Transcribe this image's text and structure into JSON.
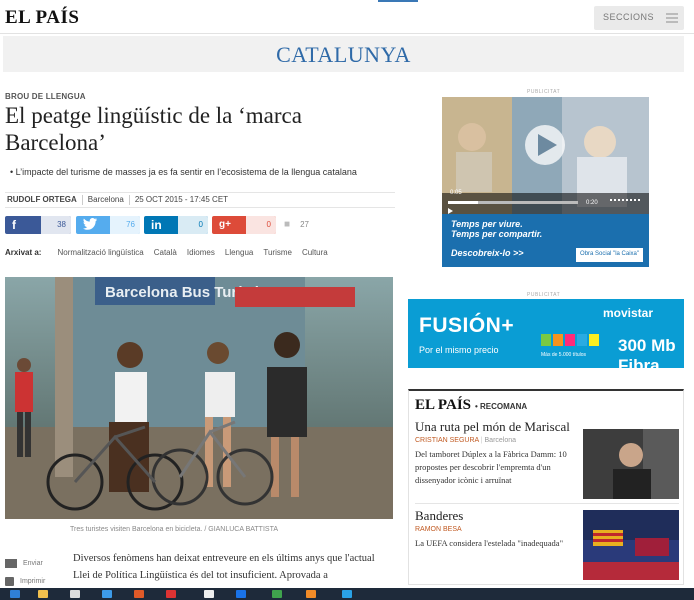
{
  "header": {
    "logo": "EL PAÍS",
    "sections_label": "SECCIONS"
  },
  "section": {
    "title": "CATALUNYA"
  },
  "article": {
    "kicker": "BROU DE LLENGUA",
    "headline": "El peatge lingüístic de la ‘marca Barcelona’",
    "subtitle": "• L’impacte del turisme de masses ja es fa sentir en l’ecosistema de la llengua catalana",
    "byline": {
      "author": "RUDOLF ORTEGA",
      "place": "Barcelona",
      "date": "25 OCT 2015 - 17:45 CET"
    },
    "share": {
      "facebook": "38",
      "twitter": "76",
      "linkedin": "0",
      "googleplus": "0",
      "comments": "27"
    },
    "archived_label": "Arxivat a:",
    "tags": [
      "Normalització lingüística",
      "Català",
      "Idiomes",
      "Llengua",
      "Turisme",
      "Cultura"
    ],
    "photo_caption": "Tres turistes visiten Barcelona en bicicleta. / GIANLUCA BATTISTA",
    "photo_sign": "Barcelona Bus Turístic",
    "tools": {
      "send": "Enviar",
      "print": "Imprimir"
    },
    "body": "Diversos fenòmens han deixat entreveure en els últims anys que l'actual Llei de Política Lingüística és del tot insuficient. Aprovada a"
  },
  "ads": {
    "label": "PUBLICITAT",
    "ad1": {
      "time_start": "0:05",
      "time_end": "0:20",
      "line1": "Temps per viure.",
      "line2": "Temps per compartir.",
      "cta": "Descobreix-lo >>",
      "brand": "Obra Social \"la Caixa\""
    },
    "ad2": {
      "title": "FUSIÓN+",
      "sub": "Por el mismo precio",
      "brand": "movistar",
      "fibra": "300 Mb Fibra",
      "titles": "Más de 5.000 títulos"
    }
  },
  "recommends": {
    "logo": "EL PAÍS",
    "label": "• RECOMANA",
    "items": [
      {
        "title": "Una ruta pel món de Mariscal",
        "author": "CRISTIAN SEGURA",
        "place": "Barcelona",
        "desc": "Del tamboret Dúplex a la Fàbrica Damm: 10 propostes per descobrir l'empremta d'un dissenyador icònic i arruïnat"
      },
      {
        "title": "Banderes",
        "author": "RAMON BESA",
        "place": "",
        "desc": "La UEFA considera l'estelada \"inadequada\""
      }
    ]
  },
  "colors": {
    "section_blue": "#2f6aa8",
    "facebook": "#3b5998",
    "twitter": "#55acee",
    "linkedin": "#0077b5",
    "googleplus": "#dd4b39",
    "caixa_blue": "#1b6fae",
    "movistar_blue": "#0a9dd4"
  }
}
